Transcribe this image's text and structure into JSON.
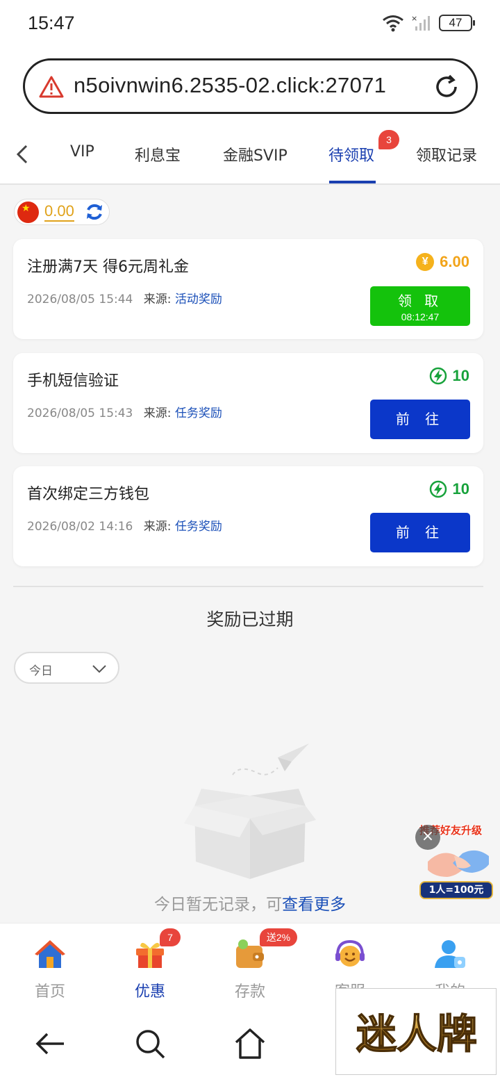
{
  "status_bar": {
    "time": "15:47",
    "battery": "47"
  },
  "browser": {
    "url": "n5oivnwin6.2535-02.click:27071"
  },
  "tabs": {
    "items": [
      {
        "label": "VIP"
      },
      {
        "label": "利息宝"
      },
      {
        "label": "金融SVIP"
      },
      {
        "label": "待领取",
        "active": true
      },
      {
        "label": "领取记录"
      }
    ],
    "pending_badge": "3"
  },
  "balance": {
    "value": "0.00"
  },
  "rewards": [
    {
      "title": "注册满7天 得6元周礼金",
      "date": "2026/08/05 15:44",
      "source_label": "来源:",
      "source": "活动奖励",
      "amount": "6.00",
      "amount_icon": "yuan-coin-icon",
      "button": "领 取",
      "countdown": "08:12:47"
    },
    {
      "title": "手机短信验证",
      "date": "2026/08/05 15:43",
      "source_label": "来源:",
      "source": "任务奖励",
      "amount": "10",
      "amount_icon": "lightning-icon",
      "button": "前 往"
    },
    {
      "title": "首次绑定三方钱包",
      "date": "2026/08/02 14:16",
      "source_label": "来源:",
      "source": "任务奖励",
      "amount": "10",
      "amount_icon": "lightning-icon",
      "button": "前 往"
    }
  ],
  "expired": {
    "title": "奖励已过期",
    "filter": "今日",
    "empty_text": "今日暂无记录，可",
    "empty_link": "查看更多"
  },
  "promo": {
    "top_text": "推荐好友升级",
    "bottom_text": "1人=100元"
  },
  "bottom_nav": {
    "items": [
      {
        "label": "首页",
        "icon": "home-icon"
      },
      {
        "label": "优惠",
        "icon": "gift-icon",
        "active": true,
        "badge": "7"
      },
      {
        "label": "存款",
        "icon": "wallet-icon",
        "badge": "送2%"
      },
      {
        "label": "客服",
        "icon": "support-icon"
      },
      {
        "label": "我的",
        "icon": "user-icon"
      }
    ]
  },
  "watermark": {
    "text": "迷人牌"
  },
  "colors": {
    "accent": "#1a3fb0",
    "claim_green": "#14c20c",
    "go_blue": "#0b37c9",
    "gold": "#f2a41a",
    "amount_green": "#17a23b",
    "badge_red": "#e8453c"
  }
}
